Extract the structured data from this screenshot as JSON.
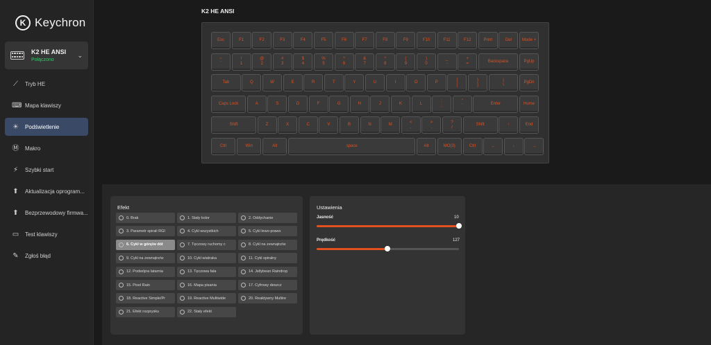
{
  "app": {
    "brand": "Keychron"
  },
  "device": {
    "name": "K2 HE ANSI",
    "status": "Połączono"
  },
  "nav": [
    {
      "label": "Tryb HE",
      "icon": "he-mode-icon",
      "active": false
    },
    {
      "label": "Mapa klawiszy",
      "icon": "keymap-icon",
      "active": false
    },
    {
      "label": "Podświetlenie",
      "icon": "backlight-icon",
      "active": true
    },
    {
      "label": "Makro",
      "icon": "macro-icon",
      "active": false
    },
    {
      "label": "Szybki start",
      "icon": "quick-start-icon",
      "active": false
    },
    {
      "label": "Aktualizacja oprogram...",
      "icon": "firmware-update-icon",
      "active": false
    },
    {
      "label": "Bezprzewodowy firmwa...",
      "icon": "wireless-firmware-icon",
      "active": false
    },
    {
      "label": "Test klawiszy",
      "icon": "key-test-icon",
      "active": false
    },
    {
      "label": "Zgłoś błąd",
      "icon": "report-bug-icon",
      "active": false
    }
  ],
  "keyboard": {
    "title": "K2 HE ANSI",
    "legend_color": "#e2501f",
    "rows": [
      [
        [
          "Esc"
        ],
        [
          "F1"
        ],
        [
          "F2"
        ],
        [
          "F3"
        ],
        [
          "F4"
        ],
        [
          "F5"
        ],
        [
          "F6"
        ],
        [
          "F7"
        ],
        [
          "F8"
        ],
        [
          "F9"
        ],
        [
          "F10"
        ],
        [
          "F11"
        ],
        [
          "F12"
        ],
        [
          "Print"
        ],
        [
          "Del"
        ],
        [
          "Mode +"
        ]
      ],
      [
        [
          "~",
          "`"
        ],
        [
          "!",
          "1"
        ],
        [
          "@",
          "2"
        ],
        [
          "#",
          "3"
        ],
        [
          "$",
          "4"
        ],
        [
          "%",
          "5"
        ],
        [
          "^",
          "6"
        ],
        [
          "&",
          "7"
        ],
        [
          "*",
          "8"
        ],
        [
          "(",
          "9"
        ],
        [
          ")",
          "0"
        ],
        [
          "_",
          "-"
        ],
        [
          "+",
          "="
        ],
        [
          "Backspace"
        ],
        [
          "PgUp"
        ]
      ],
      [
        [
          "Tab"
        ],
        [
          "Q"
        ],
        [
          "W"
        ],
        [
          "E"
        ],
        [
          "R"
        ],
        [
          "T"
        ],
        [
          "Y"
        ],
        [
          "U"
        ],
        [
          "I"
        ],
        [
          "O"
        ],
        [
          "P"
        ],
        [
          "{",
          "["
        ],
        [
          "}",
          "]"
        ],
        [
          "|",
          "\\"
        ],
        [
          "PgDn"
        ]
      ],
      [
        [
          "Caps Lock"
        ],
        [
          "A"
        ],
        [
          "S"
        ],
        [
          "D"
        ],
        [
          "F"
        ],
        [
          "G"
        ],
        [
          "H"
        ],
        [
          "J"
        ],
        [
          "K"
        ],
        [
          "L"
        ],
        [
          ":",
          ";"
        ],
        [
          "\"",
          "'"
        ],
        [
          "Enter"
        ],
        [
          "Home"
        ]
      ],
      [
        [
          "Shift"
        ],
        [
          "Z"
        ],
        [
          "X"
        ],
        [
          "C"
        ],
        [
          "V"
        ],
        [
          "B"
        ],
        [
          "N"
        ],
        [
          "M"
        ],
        [
          "<",
          ","
        ],
        [
          ">",
          "."
        ],
        [
          "?",
          "/"
        ],
        [
          "Shift"
        ],
        [
          "↑"
        ],
        [
          "End"
        ]
      ],
      [
        [
          "Ctrl"
        ],
        [
          "Win"
        ],
        [
          "Alt"
        ],
        [
          "space"
        ],
        [
          "Alt"
        ],
        [
          "MO(3)"
        ],
        [
          "Ctrl"
        ],
        [
          "←"
        ],
        [
          "↓"
        ],
        [
          "→"
        ]
      ]
    ]
  },
  "effects": {
    "title": "Efekt",
    "items": [
      "0. Brak",
      "1. Stały kolor",
      "2. Oddychanie",
      "3. Parametr spirali RGI",
      "4. Cykl wszystkich",
      "5. Cykl lewo-prawo",
      "6. Cykl w górę/w dół",
      "7. Tęczowy ruchomy c",
      "8. Cykl na zewnątrz/w",
      "9. Cykl na zewnątrz/w",
      "10. Cykl wiatraka",
      "11. Cykl spiralny",
      "12. Podwójna latarnia",
      "13. Tęczowa fala",
      "14. Jellybean Raindrop",
      "15. Pixel Rain",
      "16. Mapa pisania",
      "17. Cyfrowy deszcz",
      "18. Reactive Simple/Pr",
      "19. Reactive Multiwide",
      "20. Reaktywny Multire",
      "21. Efekt rozprysku",
      "22. Stały efekt"
    ],
    "active_index": 6
  },
  "settings": {
    "title": "Ustawienia",
    "brightness": {
      "label": "Jasność",
      "value": 10,
      "max": 10
    },
    "speed": {
      "label": "Prędkość",
      "value": 127,
      "max": 255
    }
  }
}
